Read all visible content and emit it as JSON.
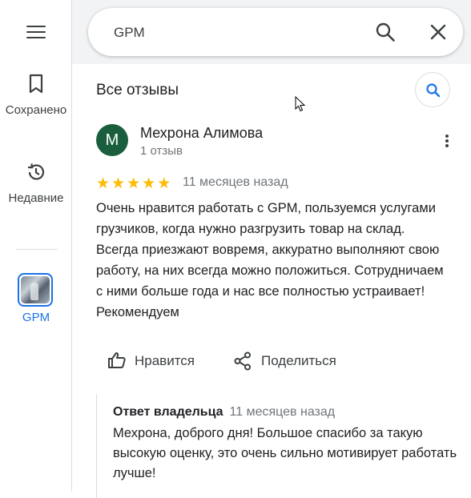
{
  "rail": {
    "saved_label": "Сохранено",
    "recent_label": "Недавние",
    "place_label": "GPM"
  },
  "search": {
    "value": "GPM"
  },
  "section": {
    "title": "Все отзывы"
  },
  "review": {
    "avatar_letter": "М",
    "author": "Мехрона Алимова",
    "reviews_count": "1 отзыв",
    "rating": 5,
    "date": "11 месяцев назад",
    "text": "Очень нравится работать с GPM, пользуемся услугами грузчиков,  когда нужно разгрузить товар на склад. Всегда приезжают вовремя, аккуратно выполняют свою работу, на них всегда можно положиться. Сотрудничаем с ними больше года и нас все полностью устраивает! Рекомендуем",
    "like_label": "Нравится",
    "share_label": "Поделиться"
  },
  "owner_reply": {
    "title": "Ответ владельца",
    "date": "11 месяцев назад",
    "text": "Мехрона, доброго дня! Большое спасибо за такую высокую оценку, это очень сильно мотивирует работать лучше!"
  },
  "colors": {
    "accent": "#1a73e8",
    "star": "#fbbc04",
    "avatar_bg": "#1b5e3f"
  }
}
